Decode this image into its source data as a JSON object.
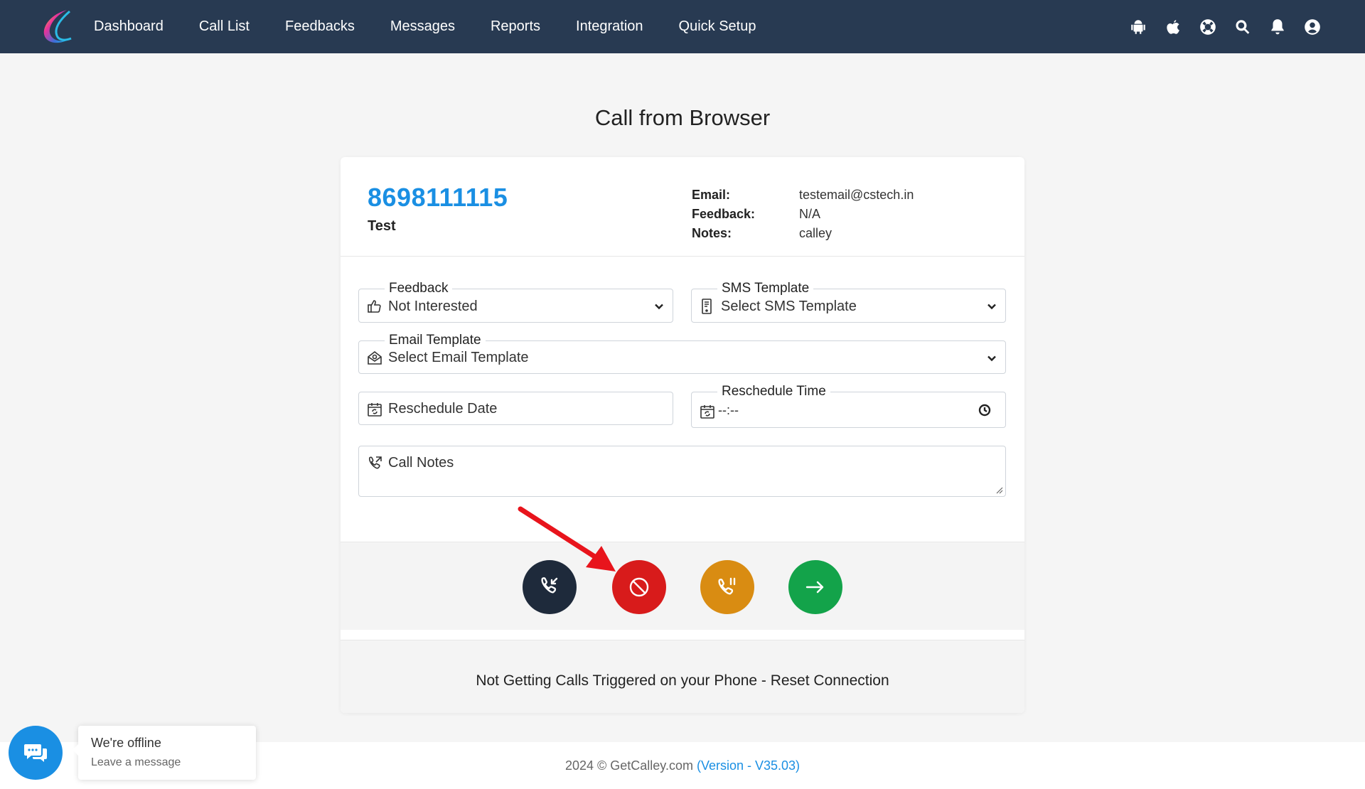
{
  "nav": {
    "links": [
      "Dashboard",
      "Call List",
      "Feedbacks",
      "Messages",
      "Reports",
      "Integration",
      "Quick Setup"
    ],
    "icons": [
      "android-icon",
      "apple-icon",
      "help-lifebuoy-icon",
      "search-icon",
      "bell-icon",
      "user-icon"
    ]
  },
  "page": {
    "title": "Call from Browser"
  },
  "contact": {
    "phone": "8698111115",
    "name": "Test",
    "email_label": "Email:",
    "email": "testemail@cstech.in",
    "feedback_label": "Feedback:",
    "feedback": "N/A",
    "notes_label": "Notes:",
    "notes": "calley"
  },
  "form": {
    "feedback_label": "Feedback",
    "feedback_value": "Not Interested",
    "sms_label": "SMS Template",
    "sms_value": "Select SMS Template",
    "email_label": "Email Template",
    "email_value": "Select Email Template",
    "reschedule_date_placeholder": "Reschedule Date",
    "reschedule_time_label": "Reschedule Time",
    "reschedule_time_value": "--:--",
    "call_notes_placeholder": "Call Notes"
  },
  "actions": {
    "colors": {
      "answer": "#1e2a3b",
      "reject": "#d81b1b",
      "hold": "#d98c12",
      "next": "#13a34a"
    }
  },
  "reset": {
    "text": "Not Getting Calls Triggered on your Phone - Reset Connection"
  },
  "footer": {
    "copyright": "2024 © GetCalley.com ",
    "version": "(Version - V35.03)"
  },
  "chat": {
    "title": "We're offline",
    "subtitle": "Leave a message"
  }
}
